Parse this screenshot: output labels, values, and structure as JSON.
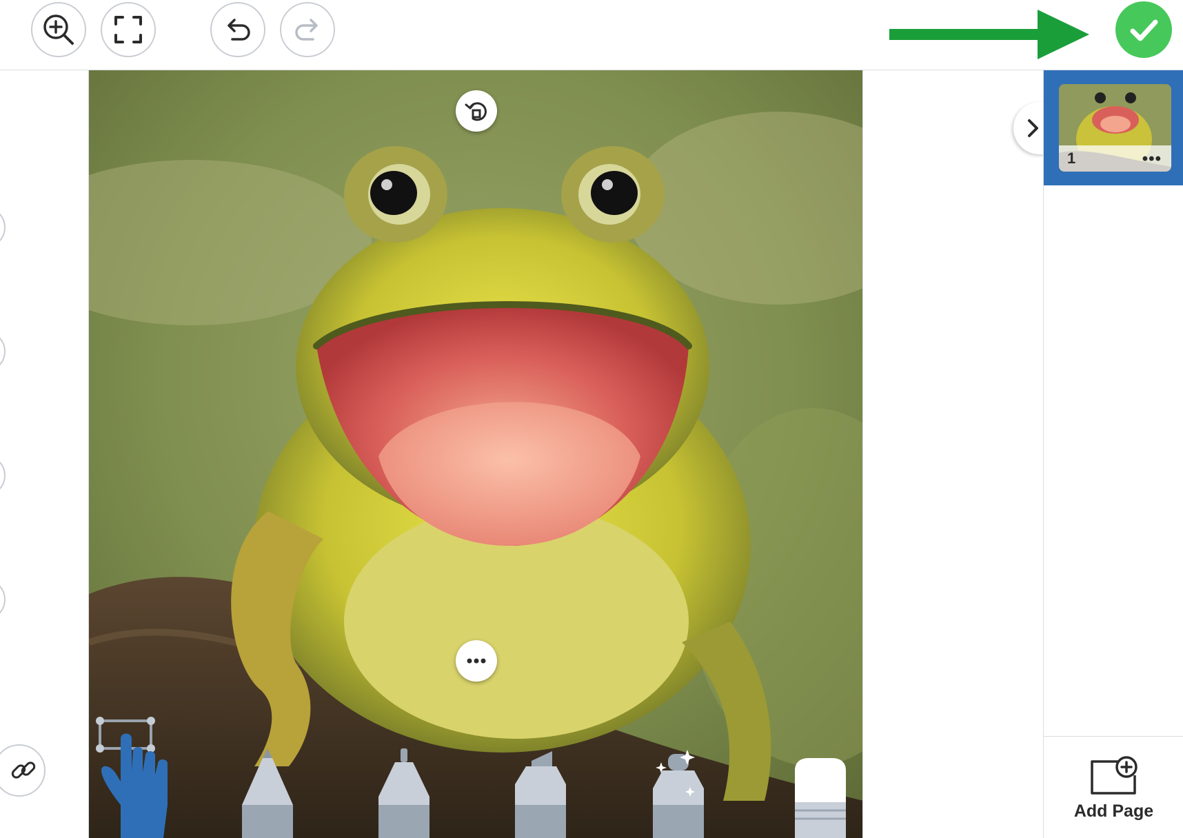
{
  "toolbar": {
    "zoom_icon": "zoom-in-icon",
    "fullscreen_icon": "fullscreen-icon",
    "undo_icon": "undo-icon",
    "redo_icon": "redo-icon",
    "done_icon": "check-icon",
    "arrow_color": "#1a9e3a",
    "done_color": "#46c85a"
  },
  "canvas": {
    "image_subject": "frog",
    "rotate_icon": "rotate-icon",
    "more_icon": "more-icon"
  },
  "tools": [
    {
      "name": "select-hand",
      "icon": "select-hand-icon",
      "active": true
    },
    {
      "name": "pencil",
      "icon": "pencil-icon"
    },
    {
      "name": "pen",
      "icon": "pen-icon"
    },
    {
      "name": "marker",
      "icon": "marker-icon"
    },
    {
      "name": "glitter-pen",
      "icon": "glitter-pen-icon"
    },
    {
      "name": "eraser",
      "icon": "eraser-icon"
    }
  ],
  "side": {
    "link_icon": "link-icon"
  },
  "pages": {
    "items": [
      {
        "number": "1",
        "menu": "•••",
        "selected": true
      }
    ],
    "add_page_label": "Add Page",
    "selected_color": "#2f6fb7"
  }
}
